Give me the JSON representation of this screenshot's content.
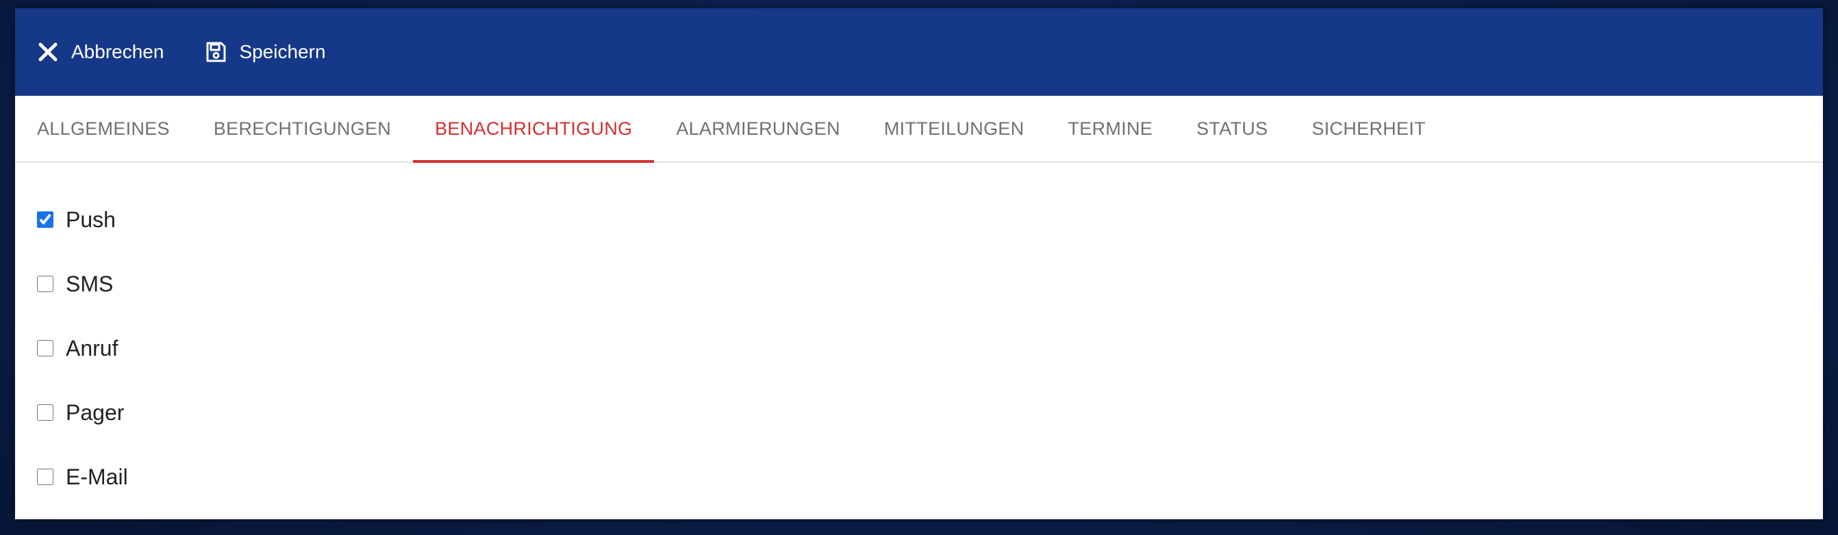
{
  "toolbar": {
    "cancel_label": "Abbrechen",
    "cancel_icon": "close-icon",
    "save_label": "Speichern",
    "save_icon": "floppy-disk-icon",
    "background": "#163888"
  },
  "tabs": [
    {
      "label": "ALLGEMEINES",
      "active": false
    },
    {
      "label": "BERECHTIGUNGEN",
      "active": false
    },
    {
      "label": "BENACHRICHTIGUNG",
      "active": true
    },
    {
      "label": "ALARMIERUNGEN",
      "active": false
    },
    {
      "label": "MITTEILUNGEN",
      "active": false
    },
    {
      "label": "TERMINE",
      "active": false
    },
    {
      "label": "STATUS",
      "active": false
    },
    {
      "label": "SICHERHEIT",
      "active": false
    }
  ],
  "active_tab_color": "#d32f2f",
  "notification_options": [
    {
      "label": "Push",
      "checked": true
    },
    {
      "label": "SMS",
      "checked": false
    },
    {
      "label": "Anruf",
      "checked": false
    },
    {
      "label": "Pager",
      "checked": false
    },
    {
      "label": "E-Mail",
      "checked": false
    }
  ]
}
